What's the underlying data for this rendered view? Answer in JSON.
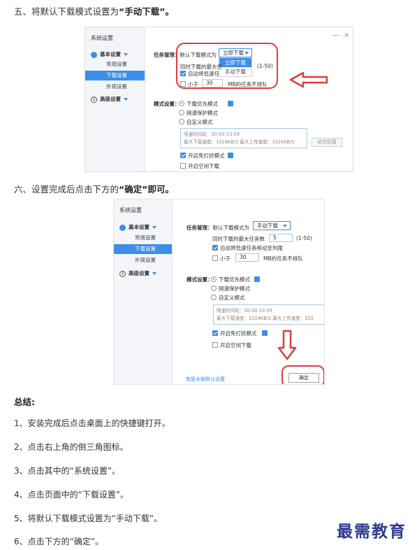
{
  "step5": {
    "prefix": "五、将默认下载模式设置为",
    "emphasis": "“手动下载”",
    "suffix": "。"
  },
  "step6": {
    "prefix": "六、设置完成后点击下方的",
    "emphasis": "“确定”即可。"
  },
  "settings": {
    "sidebar_title": "系统设置",
    "group_basic": "基本设置",
    "item_general": "常规设置",
    "item_download": "下载设置",
    "item_appearance": "外观设置",
    "group_advanced": "高级设置",
    "task_label": "任务管理：",
    "default_mode_label": "默认下载模式为",
    "mode_selected_1": "立即下载",
    "mode_selected_2": "手动下载",
    "dropdown_options": [
      "立即下载",
      "手动下载"
    ],
    "max_tasks_label_cut": "同时下载的最大任",
    "max_tasks_label": "同时下载的最大任务数",
    "max_tasks_value": "5",
    "max_tasks_range": "(1-50)",
    "auto_lowspeed_cut": "自动将低速任",
    "auto_lowspeed": "自动将低速任务移动至列尾",
    "less_than": "小于",
    "less_than_value": "30",
    "mb_exclude": "MB的任务不排队",
    "mode_label": "模式设置：",
    "mode_download_first": "下载优先模式",
    "mode_speed_protect": "网速保护模式",
    "mode_custom": "自定义模式",
    "speed_period": "限速时间段：00:00-23:59",
    "speed_limits_full": "最大下载速度：1024KB/S  最大上传速度：1024KB/S",
    "speed_limits_cut": "最大下载速度：1024KB/S  最大上传速度：102",
    "modify_config": "修改配置",
    "no_disturb": "开启免打扰模式",
    "idle_download": "开启空闲下载",
    "restore_defaults": "恢复全部默认设置",
    "confirm": "确定",
    "minimize": "—",
    "close": "×"
  },
  "summary": {
    "title": "总结:",
    "items": [
      "1、安装完成后点击桌面上的快捷键打开。",
      "2、点击右上角的倒三角图标。",
      "3、点击其中的“系统设置”。",
      "4、点击页面中的“下载设置”。",
      "5、将默认下载模式设置为“手动下载”。",
      "6、点击下方的“确定”。"
    ]
  },
  "watermark": "最需教育",
  "colors": {
    "accent": "#3c8ee8",
    "annotation_red": "#e53b3b",
    "watermark": "#2f3a8f"
  }
}
